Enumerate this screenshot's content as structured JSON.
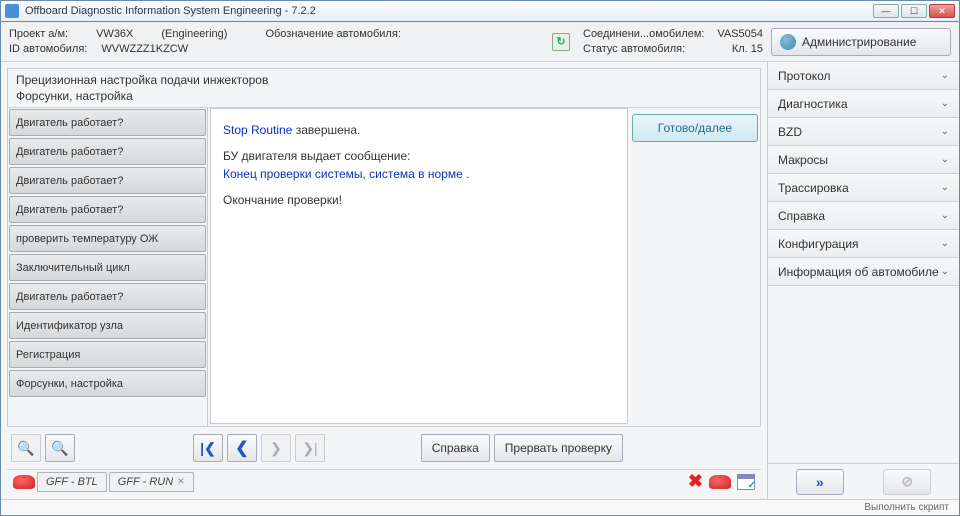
{
  "titlebar": {
    "title": "Offboard Diagnostic Information System Engineering - 7.2.2"
  },
  "header": {
    "project_label": "Проект а/м:",
    "project_val": "VW36X",
    "engineering": "(Engineering)",
    "vehicle_desig_label": "Обозначение автомобиля:",
    "vehicle_id_label": "ID автомобиля:",
    "vehicle_id_val": "WVWZZZ1KZCW",
    "conn_label": "Соединени...омобилем:",
    "conn_val": "VAS5054",
    "status_label": "Статус автомобиля:",
    "status_val": "Кл. 15",
    "admin_label": "Администрирование"
  },
  "left": {
    "title": "Прецизионная настройка подачи инжекторов",
    "subtitle": "Форсунки, настройка",
    "steps": [
      "Двигатель работает?",
      "Двигатель работает?",
      "Двигатель работает?",
      "Двигатель работает?",
      "проверить температуру ОЖ",
      "Заключительный цикл",
      "Двигатель работает?",
      "Идентификатор узла",
      "Регистрация",
      "Форсунки, настройка"
    ],
    "msg": {
      "line1a": "Stop Routine",
      "line1b": "  завершена.",
      "line2": "БУ двигателя выдает сообщение:",
      "line3": "Конец проверки системы, система в норме .",
      "line4": "Окончание проверки!"
    },
    "ready": "Готово/далее",
    "help": "Справка",
    "abort": "Прервать проверку"
  },
  "tabs": {
    "btl": "GFF - BTL",
    "run": "GFF - RUN"
  },
  "rpanel": {
    "items": [
      "Протокол",
      "Диагностика",
      "BZD",
      "Макросы",
      "Трассировка",
      "Справка",
      "Конфигурация",
      "Информация об автомобиле"
    ]
  },
  "statusbar": "Выполнить скрипт",
  "icons": {
    "first": "|❮",
    "prev": "❮",
    "next": "❯",
    "last": "❯|",
    "zoomout": "🔍",
    "zoomin": "🔍",
    "fwd": "»",
    "stop": "⊘"
  }
}
